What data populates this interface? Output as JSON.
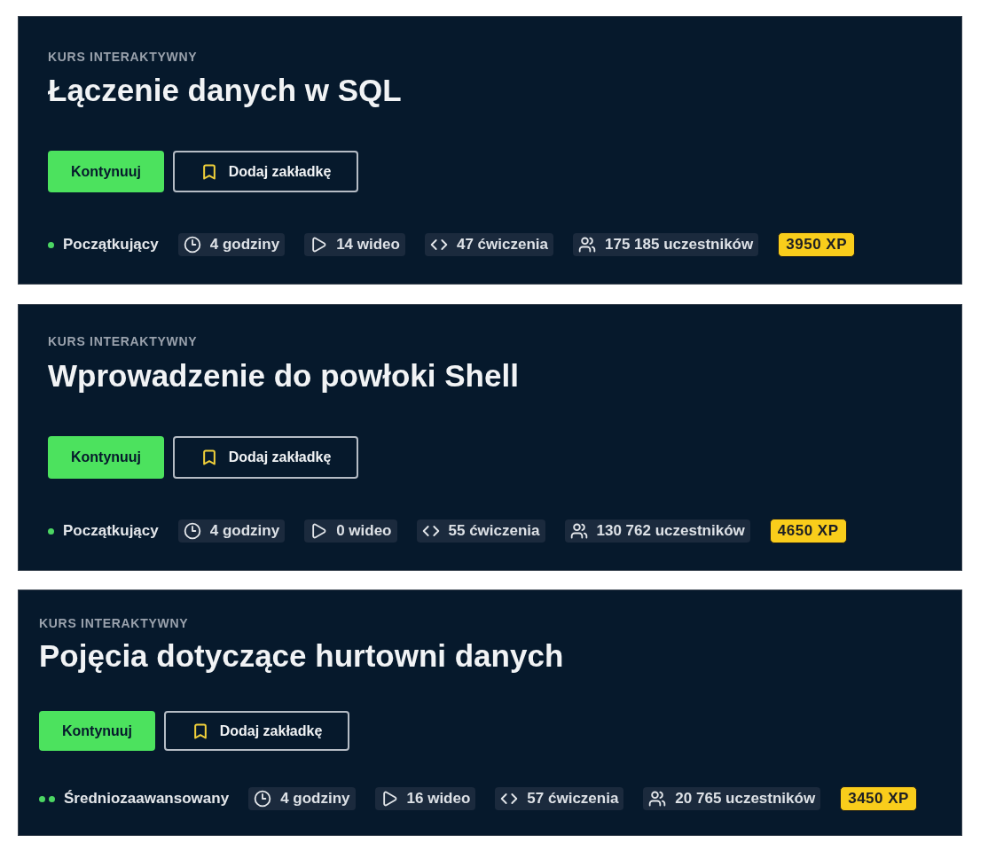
{
  "courses": [
    {
      "type_label": "KURS INTERAKTYWNY",
      "title": "Łączenie danych w SQL",
      "continue_button": "Kontynuuj",
      "bookmark_button": "Dodaj zakładkę",
      "difficulty": {
        "kind": "beginner",
        "label": "Początkujący"
      },
      "stats": [
        {
          "kind": "duration",
          "text": "4 godziny"
        },
        {
          "kind": "videos",
          "text": "14 wideo"
        },
        {
          "kind": "exercises",
          "text": "47 ćwiczenia"
        },
        {
          "kind": "participants",
          "text": "175 185 uczestników"
        }
      ],
      "xp": "3950 XP"
    },
    {
      "type_label": "KURS INTERAKTYWNY",
      "title": "Wprowadzenie do powłoki Shell",
      "continue_button": "Kontynuuj",
      "bookmark_button": "Dodaj zakładkę",
      "difficulty": {
        "kind": "beginner",
        "label": "Początkujący"
      },
      "stats": [
        {
          "kind": "duration",
          "text": "4 godziny"
        },
        {
          "kind": "videos",
          "text": "0 wideo"
        },
        {
          "kind": "exercises",
          "text": "55 ćwiczenia"
        },
        {
          "kind": "participants",
          "text": "130 762 uczestników"
        }
      ],
      "xp": "4650 XP"
    },
    {
      "type_label": "KURS INTERAKTYWNY",
      "title": "Pojęcia dotyczące hurtowni danych",
      "continue_button": "Kontynuuj",
      "bookmark_button": "Dodaj zakładkę",
      "difficulty": {
        "kind": "intermediate",
        "label": "Średniozaawansowany"
      },
      "stats": [
        {
          "kind": "duration",
          "text": "4 godziny"
        },
        {
          "kind": "videos",
          "text": "16 wideo"
        },
        {
          "kind": "exercises",
          "text": "57 ćwiczenia"
        },
        {
          "kind": "participants",
          "text": "20 765 uczestników"
        }
      ],
      "xp": "3450 XP"
    }
  ]
}
